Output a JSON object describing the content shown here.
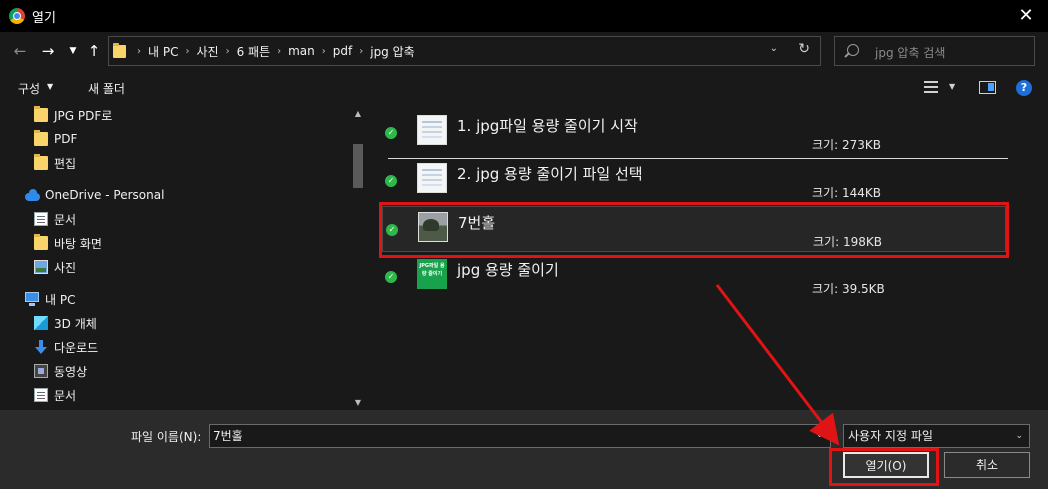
{
  "window": {
    "title": "열기"
  },
  "address": {
    "crumbs": [
      "내 PC",
      "사진",
      "6 패튼",
      "man",
      "pdf",
      "jpg 압축"
    ]
  },
  "search": {
    "placeholder": "jpg 압축 검색"
  },
  "toolbar": {
    "organize_label": "구성",
    "new_folder_label": "새 폴더"
  },
  "nav": {
    "items": [
      {
        "label": "JPG PDF로",
        "icon": "folder-icon"
      },
      {
        "label": "PDF",
        "icon": "folder-icon"
      },
      {
        "label": "편집",
        "icon": "folder-icon"
      },
      {
        "label": "OneDrive - Personal",
        "icon": "onedrive-icon"
      },
      {
        "label": "문서",
        "icon": "document-icon"
      },
      {
        "label": "바탕 화면",
        "icon": "folder-icon"
      },
      {
        "label": "사진",
        "icon": "pictures-icon"
      },
      {
        "label": "내 PC",
        "icon": "pc-icon"
      },
      {
        "label": "3D 개체",
        "icon": "3d-objects-icon"
      },
      {
        "label": "다운로드",
        "icon": "download-icon"
      },
      {
        "label": "동영상",
        "icon": "video-icon"
      },
      {
        "label": "문서",
        "icon": "document-icon"
      }
    ]
  },
  "files": [
    {
      "name": "1. jpg파일 용량 줄이기 시작",
      "size": "크기: 273KB"
    },
    {
      "name": "2. jpg 용량 줄이기 파일 선택",
      "size": "크기: 144KB"
    },
    {
      "name": "7번홀",
      "size": "크기: 198KB"
    },
    {
      "name": "jpg 용량 줄이기",
      "size": "크기: 39.5KB",
      "thumb_text": "JPG파일 용량 줄이기"
    }
  ],
  "bottom": {
    "filename_label": "파일 이름(N):",
    "filename_value": "7번홀",
    "filetype_value": "사용자 지정 파일",
    "open_label": "열기(O)",
    "cancel_label": "취소"
  },
  "colors": {
    "annotation": "#e01414",
    "check": "#2db84a"
  }
}
